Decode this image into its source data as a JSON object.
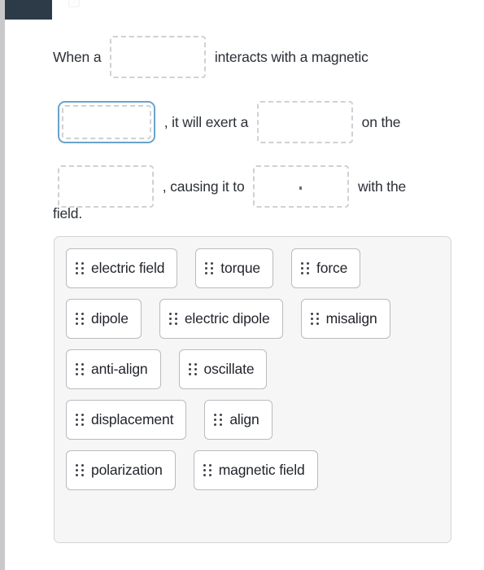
{
  "window": {
    "left_rail_color": "#c9c9cc",
    "top_bar_color": "#2d3b49"
  },
  "question": {
    "segments": [
      {
        "type": "text",
        "value": "When a"
      },
      {
        "type": "blank",
        "id": "blank-1",
        "state": "empty",
        "value": ""
      },
      {
        "type": "text",
        "value": "interacts with a magnetic"
      },
      {
        "type": "blank",
        "id": "blank-2",
        "state": "active",
        "value": ""
      },
      {
        "type": "text",
        "value": ", it will exert a"
      },
      {
        "type": "blank",
        "id": "blank-3",
        "state": "empty",
        "value": ""
      },
      {
        "type": "text",
        "value": "on the"
      },
      {
        "type": "blank",
        "id": "blank-4",
        "state": "empty",
        "value": ""
      },
      {
        "type": "text",
        "value": ", causing it to"
      },
      {
        "type": "blank",
        "id": "blank-5",
        "state": "empty",
        "value": ""
      },
      {
        "type": "text",
        "value": "with the"
      }
    ],
    "line1_text_a": "When a",
    "line1_text_b": "interacts with a magnetic",
    "line2_text_a": ", it will exert a",
    "line2_text_b": "on the",
    "line3_text_a": ", causing it to",
    "line3_text_b": "with the",
    "tail": "field."
  },
  "word_bank": {
    "rows": [
      {
        "chips": [
          {
            "label": "electric field"
          },
          {
            "label": "torque"
          },
          {
            "label": "force"
          }
        ]
      },
      {
        "chips": [
          {
            "label": "dipole"
          },
          {
            "label": "electric dipole"
          },
          {
            "label": "misalign"
          }
        ]
      },
      {
        "chips": [
          {
            "label": "anti-align"
          },
          {
            "label": "oscillate"
          }
        ]
      },
      {
        "chips": [
          {
            "label": "displacement"
          },
          {
            "label": "align"
          }
        ]
      },
      {
        "chips": [
          {
            "label": "polarization"
          },
          {
            "label": "magnetic field"
          }
        ]
      }
    ]
  },
  "colors": {
    "text": "#2b2f36",
    "blank_border": "#cfd1d4",
    "blank_active_border": "#6aa3c9",
    "bank_background": "#f6f6f7",
    "bank_border": "#d3d4d7",
    "chip_border": "#b9bbbf",
    "grip_dot": "#3f434a"
  }
}
